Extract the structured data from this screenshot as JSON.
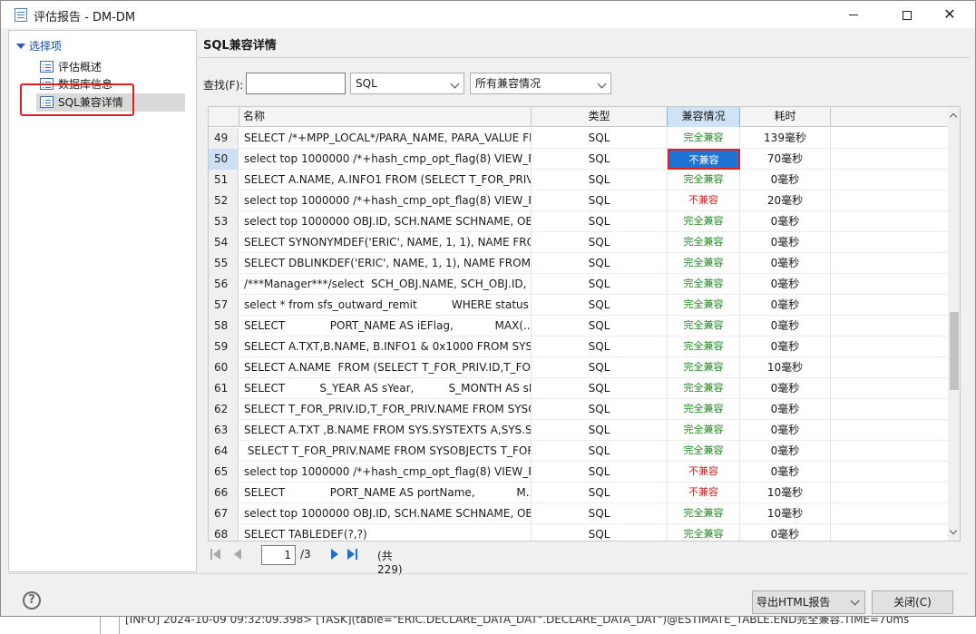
{
  "window": {
    "title": "评估报告 - DM-DM"
  },
  "tree": {
    "root_label": "选择项",
    "items": [
      {
        "label": "评估概述"
      },
      {
        "label": "数据库信息"
      },
      {
        "label": "SQL兼容详情",
        "selected": true
      }
    ]
  },
  "panel": {
    "title": "SQL兼容详情",
    "find_label": "查找(F):",
    "find_value": "",
    "type_filter": "SQL",
    "compat_filter": "所有兼容情况"
  },
  "grid": {
    "headers": {
      "name": "名称",
      "type": "类型",
      "compat": "兼容情况",
      "time": "耗时"
    },
    "rows": [
      {
        "num": "49",
        "name": "SELECT /*+MPP_LOCAL*/PARA_NAME, PARA_VALUE FR",
        "type": "SQL",
        "compat": "完全兼容",
        "status": "ok",
        "time": "139毫秒"
      },
      {
        "num": "50",
        "name": "select top 1000000 /*+hash_cmp_opt_flag(8) VIEW_FI...",
        "type": "SQL",
        "compat": "不兼容",
        "status": "bad",
        "time": "70毫秒",
        "selected": true
      },
      {
        "num": "51",
        "name": "SELECT A.NAME, A.INFO1 FROM (SELECT T_FOR_PRIV.",
        "type": "SQL",
        "compat": "完全兼容",
        "status": "ok",
        "time": "0毫秒"
      },
      {
        "num": "52",
        "name": "select top 1000000 /*+hash_cmp_opt_flag(8) VIEW_FI...",
        "type": "SQL",
        "compat": "不兼容",
        "status": "bad",
        "time": "20毫秒"
      },
      {
        "num": "53",
        "name": "select top 1000000 OBJ.ID, SCH.NAME SCHNAME, OB",
        "type": "SQL",
        "compat": "完全兼容",
        "status": "ok",
        "time": "0毫秒"
      },
      {
        "num": "54",
        "name": "SELECT SYNONYMDEF('ERIC', NAME, 1, 1), NAME FRO",
        "type": "SQL",
        "compat": "完全兼容",
        "status": "ok",
        "time": "0毫秒"
      },
      {
        "num": "55",
        "name": "SELECT DBLINKDEF('ERIC', NAME, 1, 1), NAME FROM",
        "type": "SQL",
        "compat": "完全兼容",
        "status": "ok",
        "time": "0毫秒"
      },
      {
        "num": "56",
        "name": "/***Manager***/select  SCH_OBJ.NAME, SCH_OBJ.ID, S",
        "type": "SQL",
        "compat": "完全兼容",
        "status": "ok",
        "time": "0毫秒"
      },
      {
        "num": "57",
        "name": "select * from sfs_outward_remit          WHERE status ...",
        "type": "SQL",
        "compat": "完全兼容",
        "status": "ok",
        "time": "0毫秒"
      },
      {
        "num": "58",
        "name": "SELECT             PORT_NAME AS iEFlag,            MAX(...",
        "type": "SQL",
        "compat": "完全兼容",
        "status": "ok",
        "time": "0毫秒"
      },
      {
        "num": "59",
        "name": "SELECT A.TXT,B.NAME, B.INFO1 & 0x1000 FROM SYS.S",
        "type": "SQL",
        "compat": "完全兼容",
        "status": "ok",
        "time": "0毫秒"
      },
      {
        "num": "60",
        "name": "SELECT A.NAME  FROM (SELECT T_FOR_PRIV.ID,T_FOR",
        "type": "SQL",
        "compat": "完全兼容",
        "status": "ok",
        "time": "10毫秒"
      },
      {
        "num": "61",
        "name": "SELECT          S_YEAR AS sYear,          S_MONTH AS sM...",
        "type": "SQL",
        "compat": "完全兼容",
        "status": "ok",
        "time": "0毫秒"
      },
      {
        "num": "62",
        "name": "SELECT T_FOR_PRIV.ID,T_FOR_PRIV.NAME FROM SYSO",
        "type": "SQL",
        "compat": "完全兼容",
        "status": "ok",
        "time": "0毫秒"
      },
      {
        "num": "63",
        "name": "SELECT A.TXT ,B.NAME FROM SYS.SYSTEXTS A,SYS.SYS",
        "type": "SQL",
        "compat": "完全兼容",
        "status": "ok",
        "time": "0毫秒"
      },
      {
        "num": "64",
        "name": " SELECT T_FOR_PRIV.NAME FROM SYSOBJECTS T_FOR",
        "type": "SQL",
        "compat": "完全兼容",
        "status": "ok",
        "time": "0毫秒"
      },
      {
        "num": "65",
        "name": "select top 1000000 /*+hash_cmp_opt_flag(8) VIEW_FI...",
        "type": "SQL",
        "compat": "不兼容",
        "status": "bad",
        "time": "0毫秒"
      },
      {
        "num": "66",
        "name": "SELECT             PORT_NAME AS portName,            M...",
        "type": "SQL",
        "compat": "不兼容",
        "status": "bad",
        "time": "10毫秒"
      },
      {
        "num": "67",
        "name": "select top 1000000 OBJ.ID, SCH.NAME SCHNAME, OB",
        "type": "SQL",
        "compat": "完全兼容",
        "status": "ok",
        "time": "10毫秒"
      },
      {
        "num": "68",
        "name": "SELECT TABLEDEF(?,?)",
        "type": "SQL",
        "compat": "完全兼容",
        "status": "ok",
        "time": "0毫秒"
      }
    ]
  },
  "pager": {
    "current_page": "1",
    "total_pages": "/3",
    "total_count": "(共 229)"
  },
  "footer": {
    "export_label": "导出HTML报告",
    "close_label": "关闭(C)"
  },
  "background_log": {
    "text": "[INFO] 2024-10-09 09:32:09.398> [TASK](table=\"ERIC.DECLARE_DATA_DAT\".DECLARE_DATA_DAT\")@ESTIMATE_TABLE.END完全兼容.TIME=70ms"
  },
  "colors": {
    "ok": "#1f8a1f",
    "bad": "#d61f1f",
    "selection": "#1e73d4",
    "highlight": "#e02020"
  }
}
